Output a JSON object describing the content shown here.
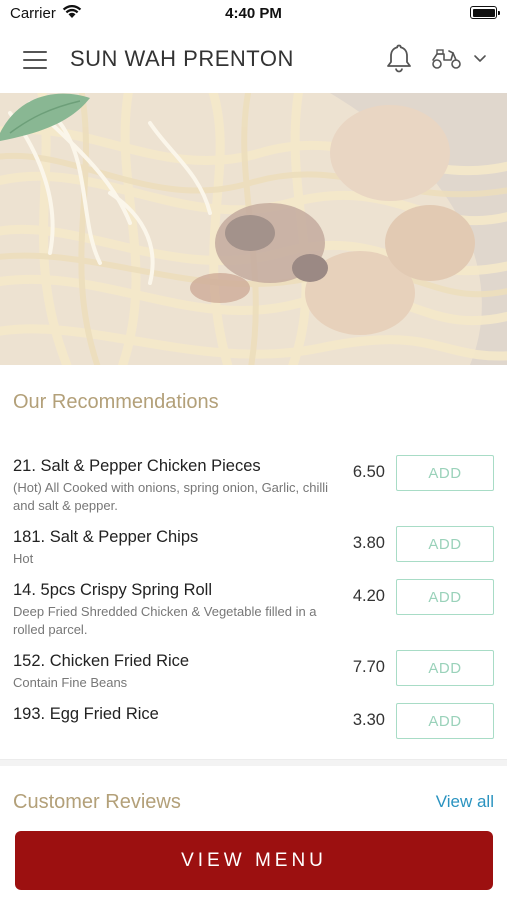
{
  "status_bar": {
    "carrier": "Carrier",
    "time": "4:40 PM"
  },
  "header": {
    "title": "SUN WAH PRENTON",
    "icons": [
      "menu-icon",
      "bell-icon",
      "scooter-icon",
      "chevron-down-icon"
    ]
  },
  "hero": {
    "image": "noodle dish with chicken, mushrooms and bean sprouts"
  },
  "recommendations": {
    "title": "Our Recommendations",
    "add_label": "ADD",
    "items": [
      {
        "name": "21. Salt & Pepper Chicken Pieces",
        "desc": "(Hot) All Cooked with onions, spring onion, Garlic, chilli and salt & pepper.",
        "price": "6.50"
      },
      {
        "name": "181. Salt & Pepper Chips",
        "desc": "Hot",
        "price": "3.80"
      },
      {
        "name": "14. 5pcs Crispy Spring Roll",
        "desc": "Deep Fried Shredded Chicken & Vegetable filled in a rolled parcel.",
        "price": "4.20"
      },
      {
        "name": "152. Chicken Fried Rice",
        "desc": "Contain Fine Beans",
        "price": "7.70"
      },
      {
        "name": "193. Egg Fried Rice",
        "desc": "",
        "price": "3.30"
      }
    ]
  },
  "reviews": {
    "title": "Customer Reviews",
    "view_all": "View all"
  },
  "footer": {
    "view_menu": "VIEW MENU"
  },
  "colors": {
    "brand_red": "#9c1010",
    "accent_gold": "#b3a079",
    "add_green": "#a8dcc6",
    "link_blue": "#2a93c0"
  }
}
